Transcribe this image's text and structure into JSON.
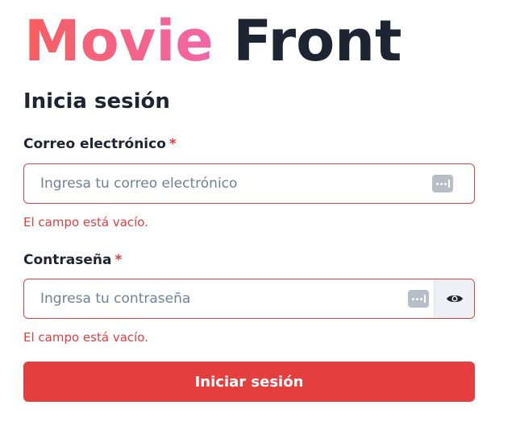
{
  "brand": {
    "word1": "Movie",
    "word2": "Front",
    "gradient_colors": [
      "#f75e5e",
      "#f167a8"
    ],
    "dark_color": "#1f2433"
  },
  "form": {
    "heading": "Inicia sesión",
    "required_marker": "*",
    "email": {
      "label": "Correo electrónico",
      "placeholder": "Ingresa tu correo electrónico",
      "value": "",
      "error": "El campo está vacío.",
      "icon": "password-manager-icon"
    },
    "password": {
      "label": "Contraseña",
      "placeholder": "Ingresa tu contraseña",
      "value": "",
      "error": "El campo está vacío.",
      "icon": "password-manager-icon",
      "toggle_icon": "eye-icon"
    },
    "submit_label": "Iniciar sesión"
  },
  "colors": {
    "error": "#e53e3e",
    "primary_button": "#e53e3e"
  }
}
